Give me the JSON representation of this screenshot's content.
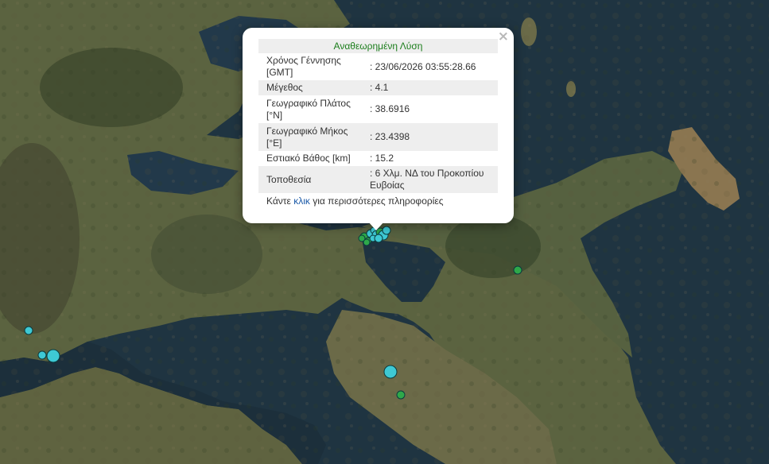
{
  "popup": {
    "title": "Αναθεωρημένη Λύση",
    "close_icon": "×",
    "rows": [
      {
        "label": "Χρόνος Γέννησης [GMT]",
        "value": ": 23/06/2026 03:55:28.66"
      },
      {
        "label": "Μέγεθος",
        "value": ": 4.1"
      },
      {
        "label": "Γεωγραφικό Πλάτος [°N]",
        "value": ": 38.6916"
      },
      {
        "label": "Γεωγραφικό Μήκος [°E]",
        "value": ": 23.4398"
      },
      {
        "label": "Εστιακό Βάθος [km]",
        "value": ": 15.2"
      },
      {
        "label": "Τοποθεσία",
        "value": ": 6 Χλμ. ΝΔ του Προκοπίου Ευβοίας"
      }
    ],
    "more_prefix": "Κάντε ",
    "more_link": "κλικ",
    "more_suffix": " για περισσότερες πληροφορίες"
  },
  "markers": {
    "cyan_color": "#3ec9d4",
    "green_color": "#2ea84a"
  }
}
